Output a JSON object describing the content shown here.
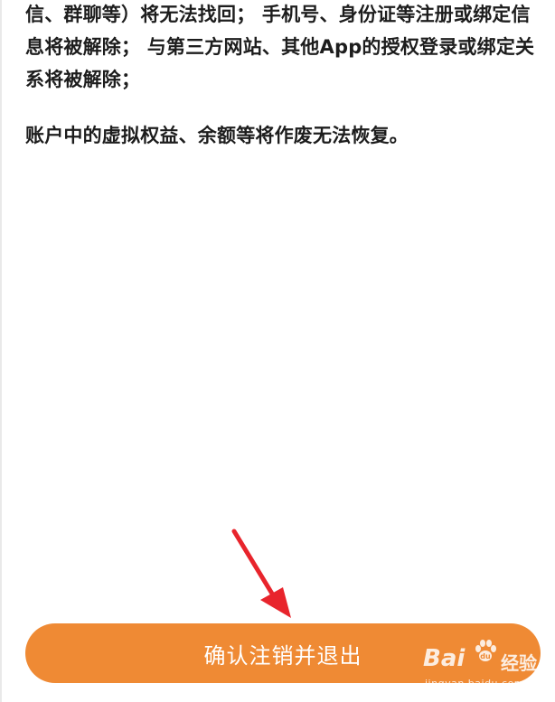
{
  "content": {
    "paragraph_1": "信、群聊等）将无法找回； 手机号、身份证等注册或绑定信息将被解除； 与第三方网站、其他App的授权登录或绑定关系将被解除；",
    "paragraph_2": "账户中的虚拟权益、余额等将作废无法恢复。"
  },
  "footer": {
    "confirm_label": "确认注销并退出"
  },
  "watermark": {
    "brand": "Bai",
    "brand_suffix": "经验",
    "url": "jingyan.baidu.com"
  },
  "colors": {
    "button": "#ef8a34",
    "text": "#1d1d1d",
    "annotation_arrow": "#e8242c"
  },
  "icons": {
    "annotation": "red-arrow-icon",
    "watermark": "baidu-paw-icon"
  }
}
